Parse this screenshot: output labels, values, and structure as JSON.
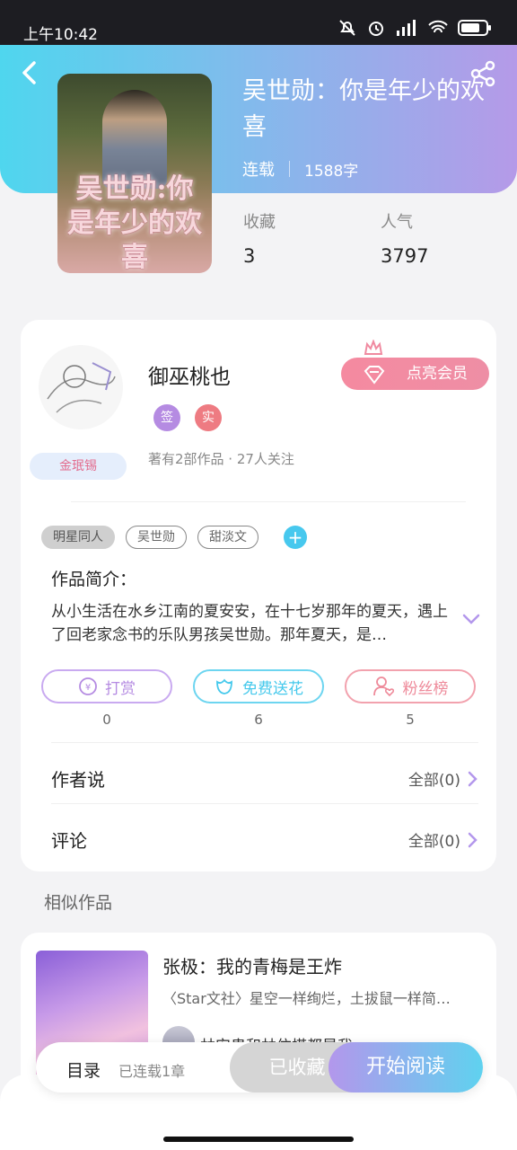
{
  "status_bar": {
    "time": "上午10:42"
  },
  "book": {
    "title": "吴世勋：你是年少的欢喜",
    "cover_text": "吴世勋:你是年少的欢喜",
    "status": "连载",
    "word_count": "1588字",
    "stats": [
      {
        "label": "收藏",
        "value": "3"
      },
      {
        "label": "人气",
        "value": "3797"
      }
    ]
  },
  "author": {
    "name": "御巫桃也",
    "badges": [
      "签",
      "实"
    ],
    "vip_button": "点亮会员",
    "level_badge": "金珉锡",
    "stats_text": "著有2部作品 · 27人关注"
  },
  "tags": [
    "明星同人",
    "吴世勋",
    "甜淡文"
  ],
  "intro": {
    "label": "作品简介：",
    "text": "从小生活在水乡江南的夏安安，在十七岁那年的夏天，遇上了回老家念书的乐队男孩吴世勋。那年夏天，是…"
  },
  "actions": [
    {
      "label": "打赏",
      "count": "0",
      "color": "#b58be2"
    },
    {
      "label": "免费送花",
      "count": "6",
      "color": "#46c9ec"
    },
    {
      "label": "粉丝榜",
      "count": "5",
      "color": "#ee8a9a"
    }
  ],
  "rows": {
    "author_says": {
      "label": "作者说",
      "right": "全部(0)"
    },
    "comments": {
      "label": "评论",
      "right": "全部(0)"
    }
  },
  "similar": {
    "section_title": "相似作品",
    "items": [
      {
        "title": "张极：我的青梅是王炸",
        "desc": "〈Star文社〉星空一样绚烂，土拔鼠一样简…",
        "author": "林安患和林依搭都是我"
      }
    ]
  },
  "bottom_bar": {
    "toc_label": "目录",
    "toc_sub": "已连载1章",
    "collected_label": "已收藏",
    "read_label": "开始阅读"
  },
  "colors": {
    "accent_purple": "#b397ec",
    "accent_cyan": "#5fd2ef",
    "vip_pink": "#f58aa0"
  }
}
